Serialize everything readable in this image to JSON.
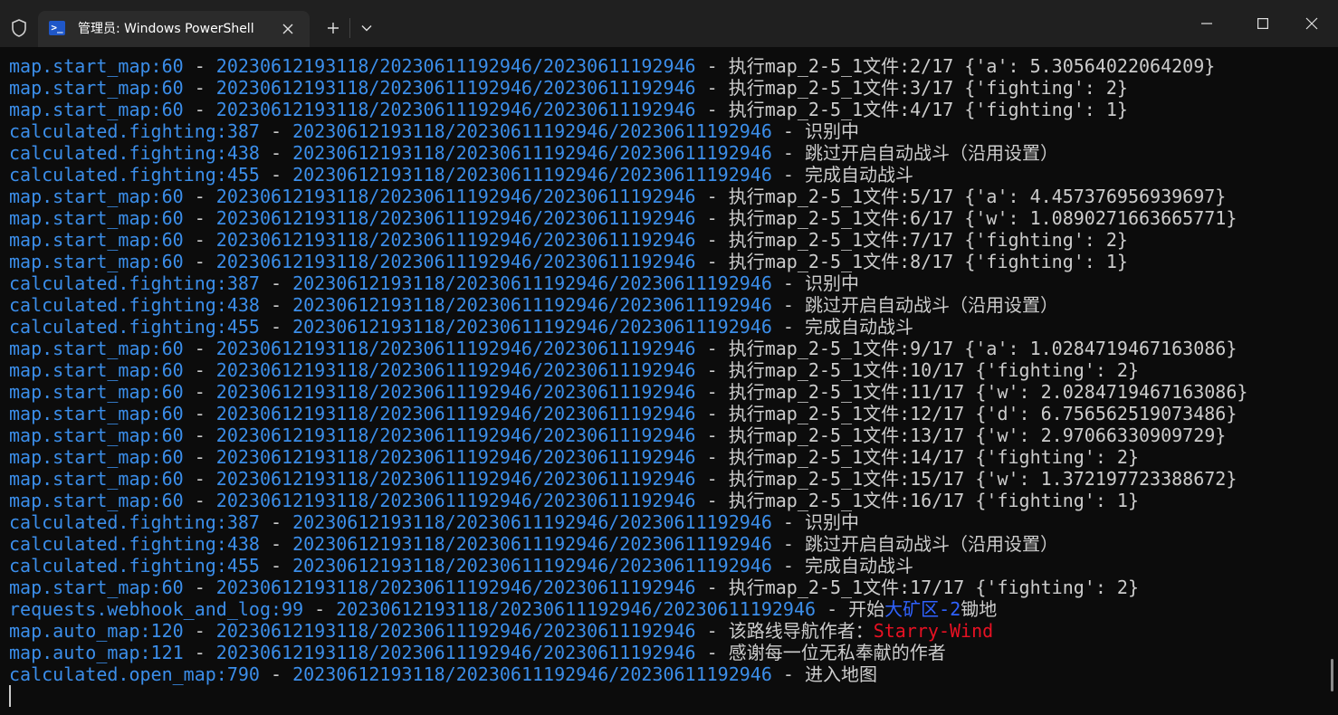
{
  "window": {
    "tab_title": "管理员: Windows PowerShell",
    "tab_icon_glyph": ">_"
  },
  "colors": {
    "module": "#3b8eea",
    "text": "#cccccc",
    "highlight_blue": "#2f62ff",
    "highlight_red": "#e81123",
    "background": "#0c0c0c"
  },
  "log_lines": [
    {
      "mod": "map.start_map:60",
      "ts": "20230612193118/20230611192946/20230611192946",
      "msg": "执行map_2-5_1文件:2/17 {'a': 5.30564022064209}"
    },
    {
      "mod": "map.start_map:60",
      "ts": "20230612193118/20230611192946/20230611192946",
      "msg": "执行map_2-5_1文件:3/17 {'fighting': 2}"
    },
    {
      "mod": "map.start_map:60",
      "ts": "20230612193118/20230611192946/20230611192946",
      "msg": "执行map_2-5_1文件:4/17 {'fighting': 1}"
    },
    {
      "mod": "calculated.fighting:387",
      "ts": "20230612193118/20230611192946/20230611192946",
      "msg": "识别中"
    },
    {
      "mod": "calculated.fighting:438",
      "ts": "20230612193118/20230611192946/20230611192946",
      "msg": "跳过开启自动战斗（沿用设置）"
    },
    {
      "mod": "calculated.fighting:455",
      "ts": "20230612193118/20230611192946/20230611192946",
      "msg": "完成自动战斗"
    },
    {
      "mod": "map.start_map:60",
      "ts": "20230612193118/20230611192946/20230611192946",
      "msg": "执行map_2-5_1文件:5/17 {'a': 4.457376956939697}"
    },
    {
      "mod": "map.start_map:60",
      "ts": "20230612193118/20230611192946/20230611192946",
      "msg": "执行map_2-5_1文件:6/17 {'w': 1.0890271663665771}"
    },
    {
      "mod": "map.start_map:60",
      "ts": "20230612193118/20230611192946/20230611192946",
      "msg": "执行map_2-5_1文件:7/17 {'fighting': 2}"
    },
    {
      "mod": "map.start_map:60",
      "ts": "20230612193118/20230611192946/20230611192946",
      "msg": "执行map_2-5_1文件:8/17 {'fighting': 1}"
    },
    {
      "mod": "calculated.fighting:387",
      "ts": "20230612193118/20230611192946/20230611192946",
      "msg": "识别中"
    },
    {
      "mod": "calculated.fighting:438",
      "ts": "20230612193118/20230611192946/20230611192946",
      "msg": "跳过开启自动战斗（沿用设置）"
    },
    {
      "mod": "calculated.fighting:455",
      "ts": "20230612193118/20230611192946/20230611192946",
      "msg": "完成自动战斗"
    },
    {
      "mod": "map.start_map:60",
      "ts": "20230612193118/20230611192946/20230611192946",
      "msg": "执行map_2-5_1文件:9/17 {'a': 1.0284719467163086}"
    },
    {
      "mod": "map.start_map:60",
      "ts": "20230612193118/20230611192946/20230611192946",
      "msg": "执行map_2-5_1文件:10/17 {'fighting': 2}"
    },
    {
      "mod": "map.start_map:60",
      "ts": "20230612193118/20230611192946/20230611192946",
      "msg": "执行map_2-5_1文件:11/17 {'w': 2.0284719467163086}"
    },
    {
      "mod": "map.start_map:60",
      "ts": "20230612193118/20230611192946/20230611192946",
      "msg": "执行map_2-5_1文件:12/17 {'d': 6.756562519073486}"
    },
    {
      "mod": "map.start_map:60",
      "ts": "20230612193118/20230611192946/20230611192946",
      "msg": "执行map_2-5_1文件:13/17 {'w': 2.97066330909729}"
    },
    {
      "mod": "map.start_map:60",
      "ts": "20230612193118/20230611192946/20230611192946",
      "msg": "执行map_2-5_1文件:14/17 {'fighting': 2}"
    },
    {
      "mod": "map.start_map:60",
      "ts": "20230612193118/20230611192946/20230611192946",
      "msg": "执行map_2-5_1文件:15/17 {'w': 1.372197723388672}"
    },
    {
      "mod": "map.start_map:60",
      "ts": "20230612193118/20230611192946/20230611192946",
      "msg": "执行map_2-5_1文件:16/17 {'fighting': 1}"
    },
    {
      "mod": "calculated.fighting:387",
      "ts": "20230612193118/20230611192946/20230611192946",
      "msg": "识别中"
    },
    {
      "mod": "calculated.fighting:438",
      "ts": "20230612193118/20230611192946/20230611192946",
      "msg": "跳过开启自动战斗（沿用设置）"
    },
    {
      "mod": "calculated.fighting:455",
      "ts": "20230612193118/20230611192946/20230611192946",
      "msg": "完成自动战斗"
    },
    {
      "mod": "map.start_map:60",
      "ts": "20230612193118/20230611192946/20230611192946",
      "msg": "执行map_2-5_1文件:17/17 {'fighting': 2}"
    },
    {
      "mod": "requests.webhook_and_log:99",
      "ts": "20230612193118/20230611192946/20230611192946",
      "msg": "开始",
      "hl": "大矿区-2",
      "hl_color": "highlight_blue",
      "after": "锄地"
    },
    {
      "mod": "map.auto_map:120",
      "ts": "20230612193118/20230611192946/20230611192946",
      "msg": "该路线导航作者：",
      "hl": "Starry-Wind",
      "hl_color": "highlight_red",
      "after": ""
    },
    {
      "mod": "map.auto_map:121",
      "ts": "20230612193118/20230611192946/20230611192946",
      "msg": "感谢每一位无私奉献的作者"
    },
    {
      "mod": "calculated.open_map:790",
      "ts": "20230612193118/20230611192946/20230611192946",
      "msg": "进入地图"
    }
  ]
}
